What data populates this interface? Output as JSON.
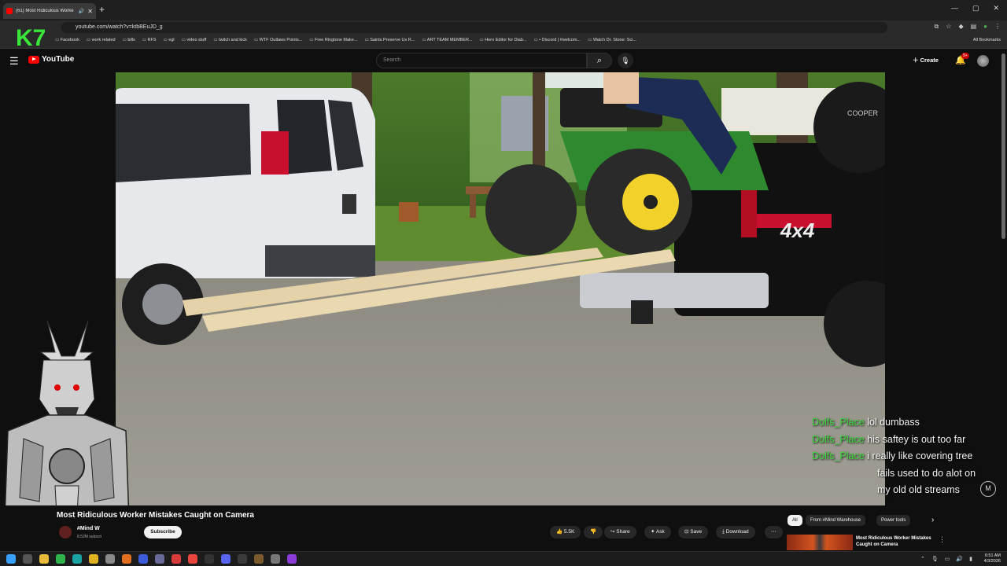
{
  "browser": {
    "tab_title": "(61) Most Ridiculous Worke",
    "url": "youtube.com/watch?v=ktbBEuJD_g",
    "bookmarks": [
      "Facebook",
      "work related",
      "bills",
      "RFS",
      "egl",
      "video stuff",
      "twitch and kick",
      "WTF Outlaws Points...",
      "Free Ringtone Make...",
      "Saints Preserve Us R...",
      "ART TEAM MEMBER...",
      "Hero Editor for Diab...",
      "• Discord | #welcom...",
      "Watch Dr. Stone: Sci..."
    ],
    "all_bookmarks": "All Bookmarks"
  },
  "youtube": {
    "logo_text": "YouTube",
    "search_placeholder": "Search",
    "create_label": "Create",
    "notification_count": "9+"
  },
  "video": {
    "title": "Most Ridiculous Worker Mistakes Caught on Camera",
    "channel_name": "#Mind W",
    "subscribers": "8.52M subscri",
    "subscribe_label": "Subscribe",
    "likes": "5.5K",
    "share_label": "Share",
    "ask_label": "Ask",
    "save_label": "Save",
    "download_label": "Download",
    "truck_badge": "4x4",
    "tire_brand": "COOPER"
  },
  "chat": [
    {
      "user": "Dolfs_Place",
      "message": "lol dumbass"
    },
    {
      "user": "Dolfs_Place",
      "message": "his saftey is out too far"
    },
    {
      "user": "Dolfs_Place",
      "message": "i really like covering tree"
    },
    {
      "user": "",
      "message": "fails used to do alot on"
    },
    {
      "user": "",
      "message": "my old old streams"
    }
  ],
  "overlay": {
    "k_logo": "K7",
    "m_badge": "M"
  },
  "chips": [
    "All",
    "From #Mind Warehouse",
    "Power tools"
  ],
  "recommended": {
    "title": "Most Ridiculous Worker Mistakes Caught on Camera"
  },
  "taskbar": {
    "time": "6:51 AM",
    "date": "4/3/2026"
  },
  "colors": {
    "chat_user": "#3ddc3d",
    "youtube_red": "#ff0000",
    "mower_green": "#2f8a2f",
    "truck_black": "#111111"
  }
}
